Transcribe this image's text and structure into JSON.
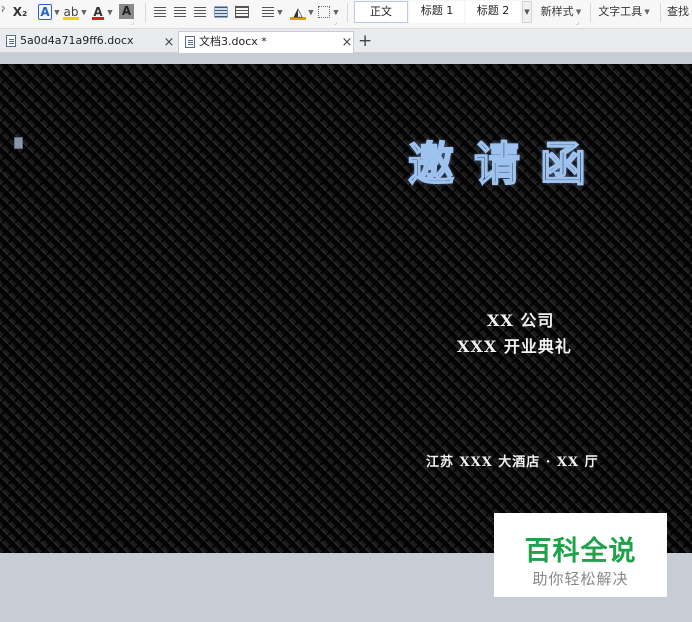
{
  "ribbon": {
    "subscript": "X₂",
    "text_effect": "A",
    "highlight": "ab",
    "font_color": "A",
    "char_shading": "A",
    "styles": [
      "正文",
      "标题 1",
      "标题 2"
    ],
    "new_style": "新样式",
    "text_tools": "文字工具",
    "find": "查找"
  },
  "tabs": [
    {
      "label": "5a0d4a71a9ff6.docx",
      "close": "×"
    },
    {
      "label": "文档3.docx *",
      "close": "×"
    }
  ],
  "tab_add": "+",
  "document": {
    "title": "邀请函",
    "company": "XX 公司",
    "ceremony": "XXX 开业典礼",
    "venue": "江苏 XXX 大酒店 · XX 厅"
  },
  "watermark": {
    "main": "百科全说",
    "sub": "助你轻松解决"
  },
  "colors": {
    "title_outline": "#9ec2ee",
    "watermark_green": "#1ea24a"
  }
}
